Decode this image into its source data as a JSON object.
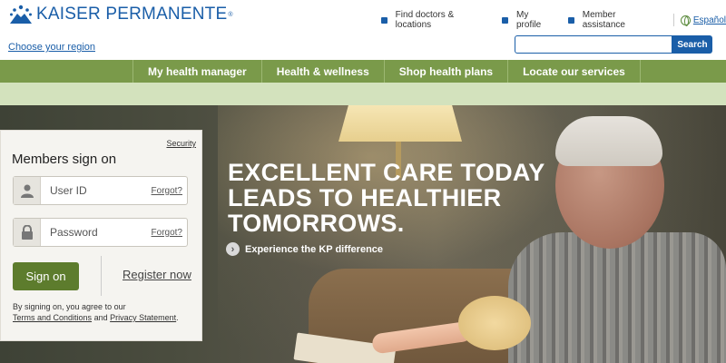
{
  "header": {
    "logo_text": "KAISER PERMANENTE",
    "logo_reg": "®",
    "utility_links": [
      {
        "label": "Find doctors & locations"
      },
      {
        "label": "My profile"
      },
      {
        "label": "Member assistance"
      }
    ],
    "language_link": "Español",
    "region_link": "Choose your region",
    "search": {
      "placeholder": "",
      "value": "",
      "button_label": "Search"
    }
  },
  "nav": {
    "items": [
      {
        "label": "My health manager"
      },
      {
        "label": "Health & wellness"
      },
      {
        "label": "Shop health plans"
      },
      {
        "label": "Locate our services"
      }
    ]
  },
  "hero": {
    "headline_line1": "EXCELLENT CARE TODAY",
    "headline_line2": "LEADS TO HEALTHIER",
    "headline_line3": "TOMORROWS.",
    "cta_label": "Experience the KP difference",
    "cta_icon": "chevron-right-circle"
  },
  "signin": {
    "security_link": "Security",
    "title": "Members sign on",
    "user_id": {
      "placeholder": "User ID",
      "forgot": "Forgot?",
      "icon": "user-icon"
    },
    "password": {
      "placeholder": "Password",
      "forgot": "Forgot?",
      "icon": "lock-icon"
    },
    "signon_button": "Sign on",
    "register_link": "Register now",
    "disclaimer_prefix": "By signing on, you agree to our",
    "terms_link": "Terms and Conditions",
    "disclaimer_and": "and",
    "privacy_link": "Privacy Statement",
    "disclaimer_end": "."
  },
  "colors": {
    "brand_blue": "#1a5ea8",
    "nav_green": "#7a9a4a",
    "subnav_green": "#d3e2bd",
    "button_green": "#5d7c2d"
  }
}
